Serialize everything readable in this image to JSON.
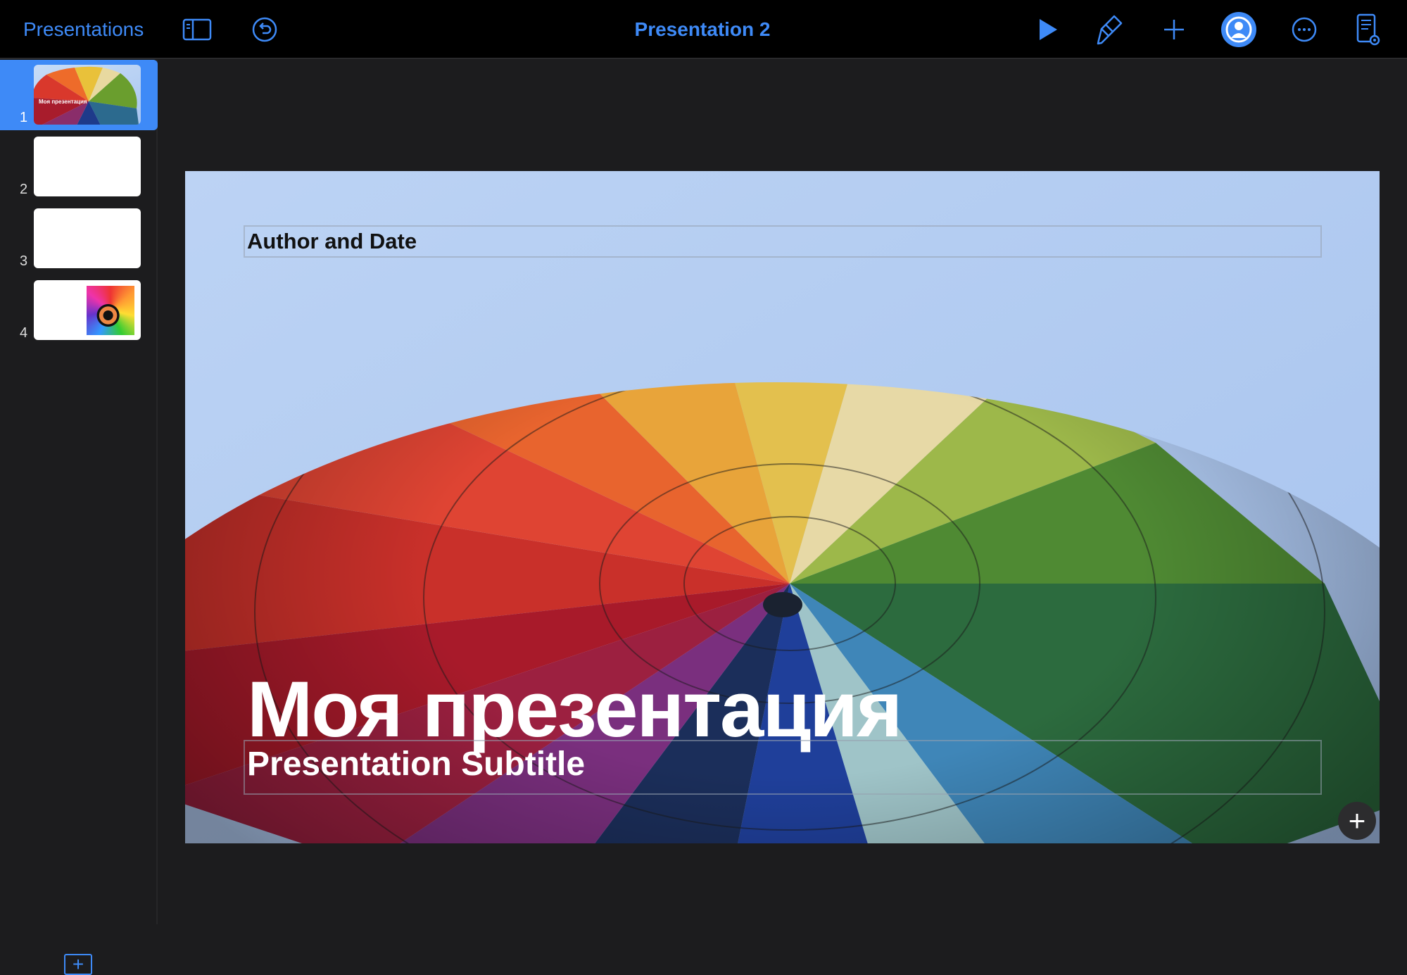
{
  "toolbar": {
    "back_label": "Presentations",
    "title": "Presentation 2",
    "icons": [
      "sidebar-toggle-icon",
      "undo-icon",
      "play-icon",
      "format-brush-icon",
      "add-icon",
      "collaborate-icon",
      "more-icon",
      "document-view-icon"
    ],
    "accent": "#3e8af7"
  },
  "sidebar": {
    "slides": [
      {
        "number": "1",
        "title": "Моя презентация"
      },
      {
        "number": "2"
      },
      {
        "number": "3"
      },
      {
        "number": "4"
      }
    ],
    "add_slide": "+"
  },
  "slide": {
    "author": "Author and Date",
    "title": "Моя презентация",
    "subtitle": "Presentation Subtitle",
    "add_object": "+"
  }
}
